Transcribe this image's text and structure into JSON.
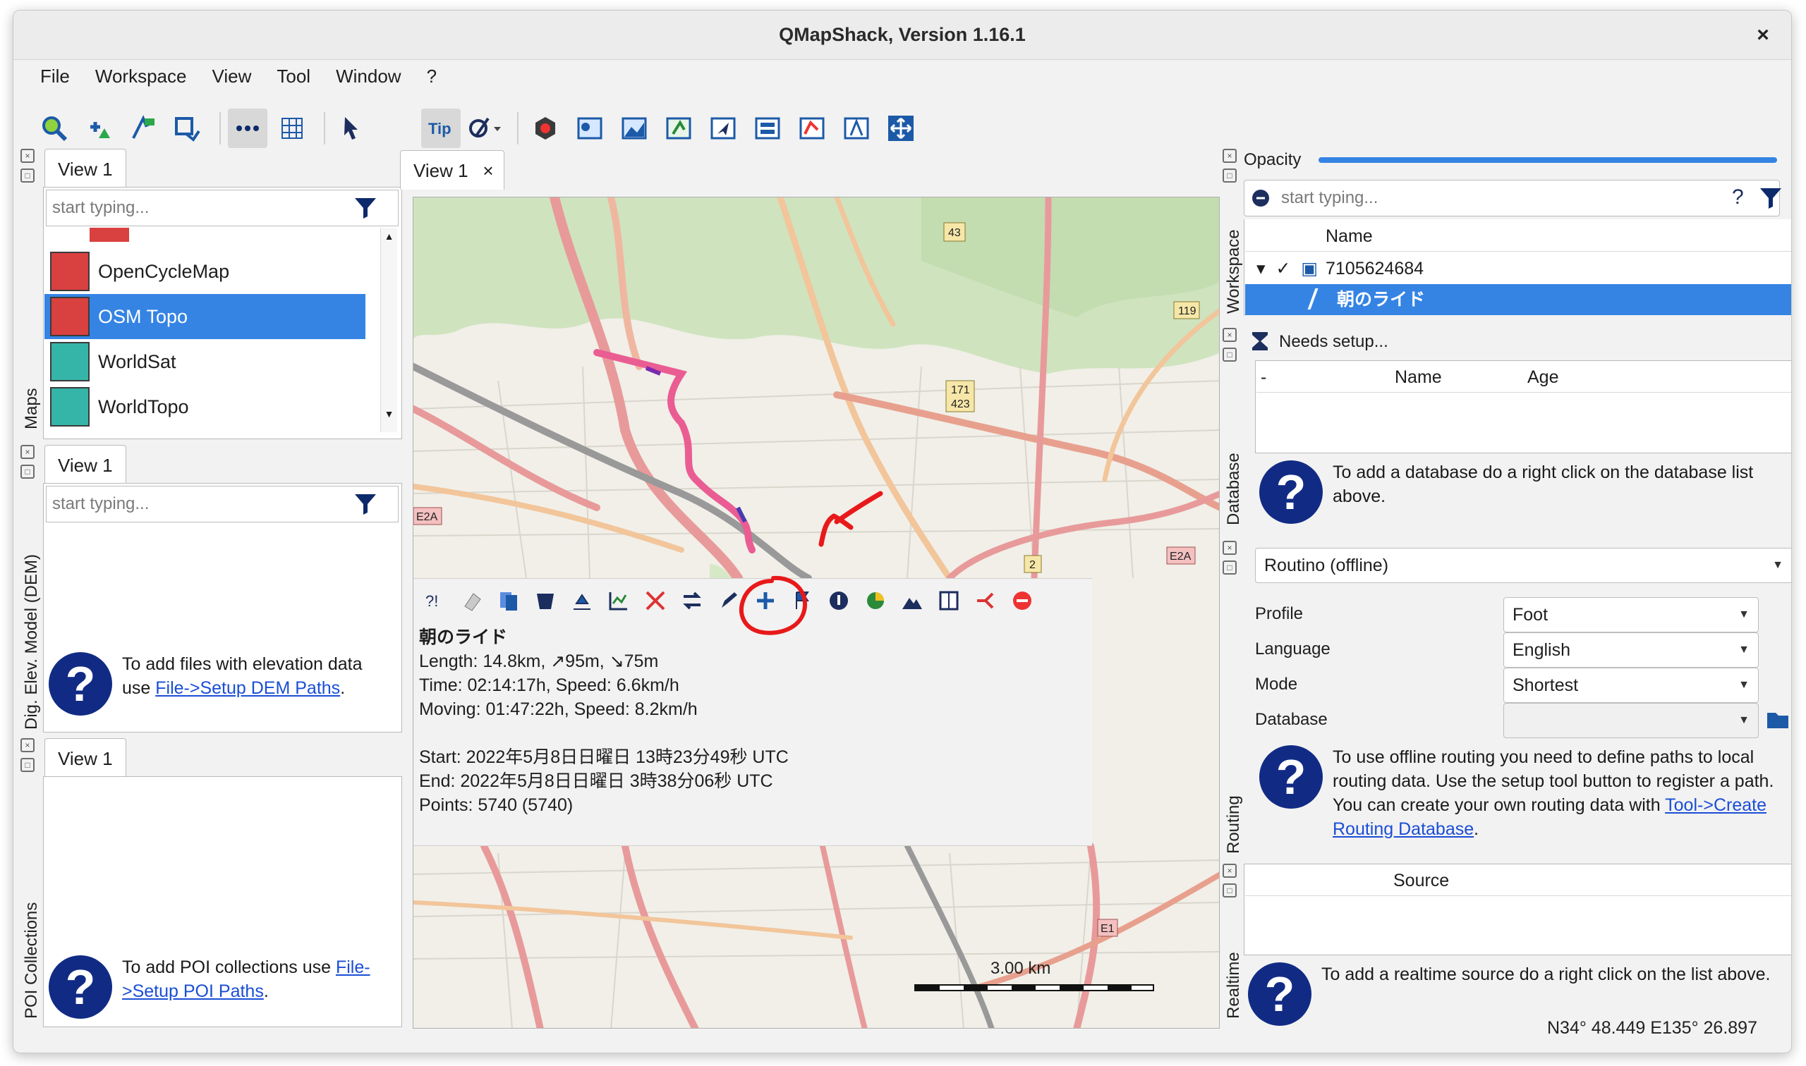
{
  "window": {
    "title": "QMapShack, Version 1.16.1",
    "close": "×"
  },
  "menu": [
    "File",
    "Workspace",
    "View",
    "Tool",
    "Window",
    "?"
  ],
  "toolbar_icons": [
    "zoom-icon",
    "add-waypoint-icon",
    "add-route-icon",
    "add-track-icon",
    "dots-icon",
    "grid-icon",
    "cursor-icon",
    "moon-icon",
    "tip-icon",
    "measure-icon",
    "gps-icon",
    "map-icon",
    "elevation-icon",
    "poi-icon",
    "navigate-icon",
    "workspace-icon",
    "database-icon",
    "routing-icon",
    "fullscreen-icon"
  ],
  "maps_dock": {
    "label": "Maps",
    "tab": "View 1",
    "filter_placeholder": "start typing...",
    "items": [
      {
        "label": "OpenCycleMap",
        "color": "#d94040"
      },
      {
        "label": "OSM Topo",
        "color": "#d94040",
        "selected": true
      },
      {
        "label": "WorldSat",
        "color": "#35b5a8"
      },
      {
        "label": "WorldTopo",
        "color": "#35b5a8"
      }
    ]
  },
  "dem_dock": {
    "label": "Dig. Elev. Model (DEM)",
    "tab": "View 1",
    "filter_placeholder": "start typing...",
    "help_prefix": "To add files with elevation data use ",
    "help_link": "File->Setup DEM Paths",
    "help_suffix": "."
  },
  "poi_dock": {
    "label": "POI Collections",
    "tab": "View 1",
    "help_prefix": "To add POI collections use ",
    "help_link": "File->Setup POI Paths",
    "help_suffix": "."
  },
  "map_view": {
    "tab": "View 1",
    "tab_close": "×",
    "road_labels": [
      "43",
      "171 423",
      "119",
      "E2A",
      "E2A",
      "2",
      "E1",
      "423"
    ],
    "scale": "3.00 km",
    "popup": {
      "name": "朝のライド",
      "length": "Length: 14.8km, ↗95m, ↘75m",
      "time": "Time: 02:14:17h, Speed: 6.6km/h",
      "moving": "Moving: 01:47:22h, Speed: 8.2km/h",
      "start": "Start: 2022年5月8日日曜日 13時23分49秒 UTC",
      "end": "End: 2022年5月8日日曜日 3時38分06秒 UTC",
      "points": "Points: 5740 (5740)",
      "tools": [
        "info-icon",
        "eraser-icon",
        "copy-icon",
        "bucket-icon",
        "profile-icon",
        "graph-icon",
        "cut-icon",
        "reverse-icon",
        "pencil-icon",
        "plus-icon",
        "flag-icon",
        "info-circle-icon",
        "activity-icon",
        "elevation-icon",
        "book-icon",
        "split-icon",
        "delete-icon"
      ]
    }
  },
  "workspace": {
    "label": "Workspace",
    "opacity_label": "Opacity",
    "filter_placeholder": "start typing...",
    "help": "?",
    "column_name": "Name",
    "project": "7105624684",
    "track": "朝のライド"
  },
  "database": {
    "label": "Database",
    "needs_setup": "Needs setup...",
    "column_name": "Name",
    "column_age": "Age",
    "help": "To add a database do a right click on the database list above."
  },
  "routing": {
    "label": "Routing",
    "engine": "Routino (offline)",
    "profile_label": "Profile",
    "profile_value": "Foot",
    "language_label": "Language",
    "language_value": "English",
    "mode_label": "Mode",
    "mode_value": "Shortest",
    "database_label": "Database",
    "help_prefix": "To use offline routing you need to define paths to local routing data. Use the setup tool button to register a path. You can create your own routing data with ",
    "help_link": "Tool->Create Routing Database",
    "help_suffix": "."
  },
  "realtime": {
    "label": "Realtime",
    "column_source": "Source",
    "help": "To add a realtime source do a right click on the list above."
  },
  "status": {
    "coords": "N34° 48.449 E135° 26.897"
  }
}
